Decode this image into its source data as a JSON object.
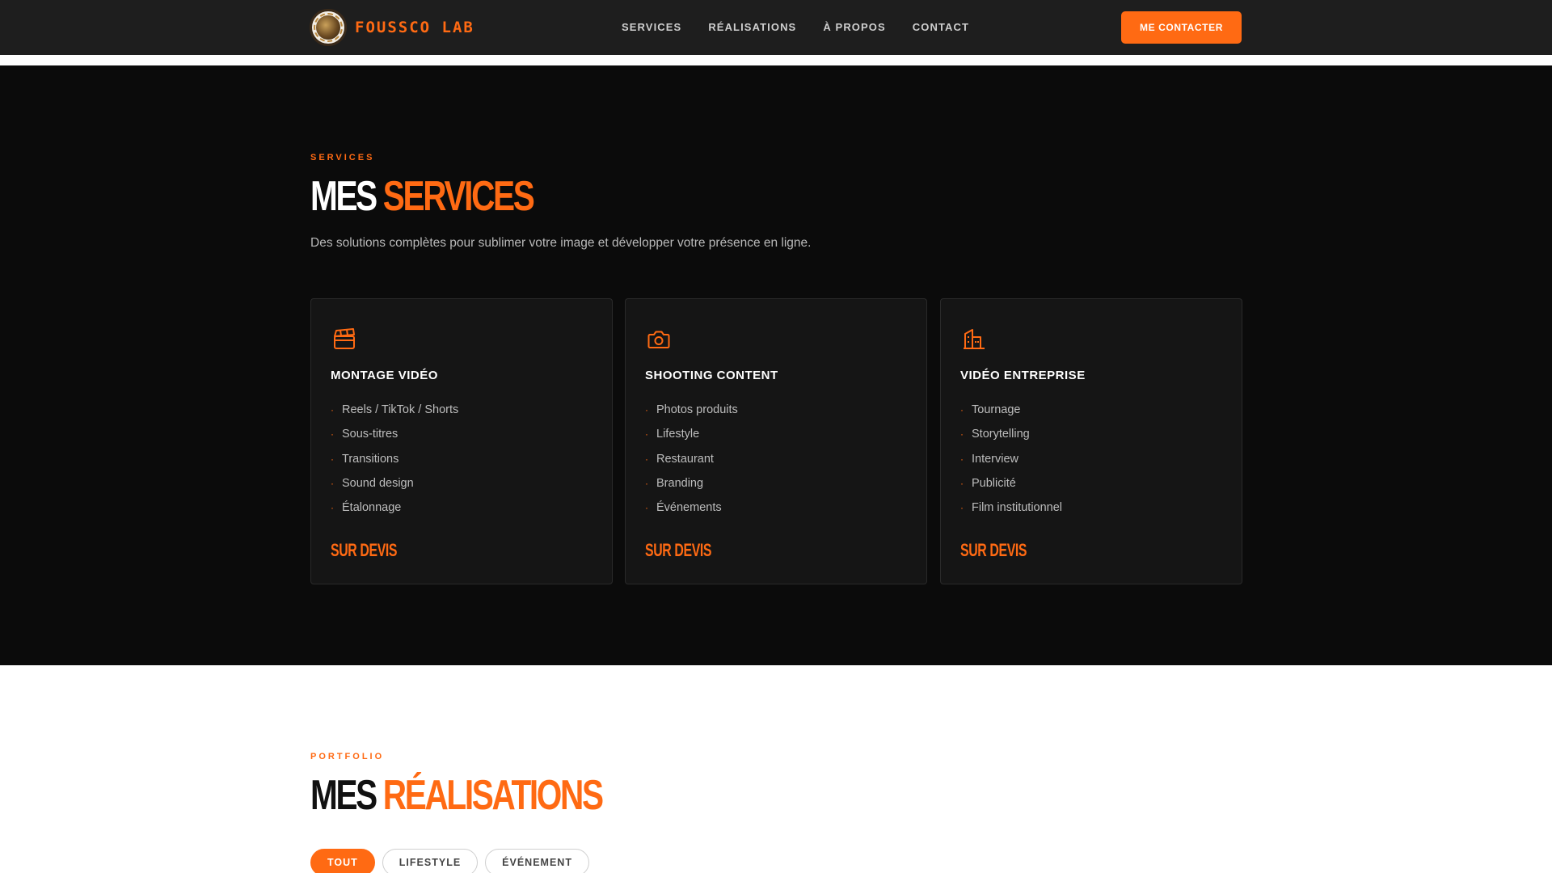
{
  "header": {
    "brand": "FOUSSCO LAB",
    "nav": [
      "SERVICES",
      "RÉALISATIONS",
      "À PROPOS",
      "CONTACT"
    ],
    "cta": "ME CONTACTER"
  },
  "services": {
    "eyebrow": "SERVICES",
    "title_main": "MES",
    "title_accent": "SERVICES",
    "lead": "Des solutions complètes pour sublimer votre image et développer votre présence en ligne.",
    "cards": [
      {
        "icon": "clapperboard-icon",
        "title": "MONTAGE VIDÉO",
        "items": [
          "Reels / TikTok / Shorts",
          "Sous-titres",
          "Transitions",
          "Sound design",
          "Étalonnage"
        ],
        "price": "SUR DEVIS"
      },
      {
        "icon": "camera-icon",
        "title": "SHOOTING CONTENT",
        "items": [
          "Photos produits",
          "Lifestyle",
          "Restaurant",
          "Branding",
          "Événements"
        ],
        "price": "SUR DEVIS"
      },
      {
        "icon": "building-icon",
        "title": "VIDÉO ENTREPRISE",
        "items": [
          "Tournage",
          "Storytelling",
          "Interview",
          "Publicité",
          "Film institutionnel"
        ],
        "price": "SUR DEVIS"
      }
    ]
  },
  "portfolio": {
    "eyebrow": "PORTFOLIO",
    "title_main": "MES",
    "title_accent": "RÉALISATIONS",
    "filters": [
      {
        "label": "TOUT",
        "active": true
      },
      {
        "label": "LIFESTYLE",
        "active": false
      },
      {
        "label": "ÉVÉNEMENT",
        "active": false
      }
    ]
  },
  "colors": {
    "accent": "#ff6a13",
    "dark": "#0b0b0b",
    "header": "#1e1e1e",
    "card": "#151515"
  }
}
